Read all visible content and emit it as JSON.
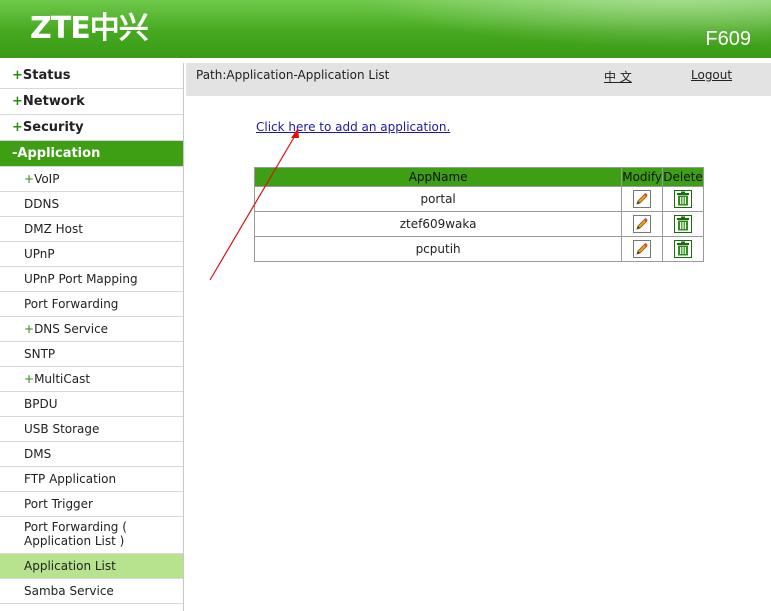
{
  "header": {
    "logo": "ZTE中兴",
    "model": "F609"
  },
  "sidebar": {
    "items": [
      {
        "sign": "+",
        "label": "Status"
      },
      {
        "sign": "+",
        "label": "Network"
      },
      {
        "sign": "+",
        "label": "Security"
      },
      {
        "sign": "-",
        "label": "Application"
      },
      {
        "sign": "+",
        "label": "VoIP"
      },
      {
        "sign": "",
        "label": "DDNS"
      },
      {
        "sign": "",
        "label": "DMZ Host"
      },
      {
        "sign": "",
        "label": "UPnP"
      },
      {
        "sign": "",
        "label": "UPnP Port Mapping"
      },
      {
        "sign": "",
        "label": "Port Forwarding"
      },
      {
        "sign": "+",
        "label": "DNS Service"
      },
      {
        "sign": "",
        "label": "SNTP"
      },
      {
        "sign": "+",
        "label": "MultiCast"
      },
      {
        "sign": "",
        "label": "BPDU"
      },
      {
        "sign": "",
        "label": "USB Storage"
      },
      {
        "sign": "",
        "label": "DMS"
      },
      {
        "sign": "",
        "label": "FTP Application"
      },
      {
        "sign": "",
        "label": "Port Trigger"
      },
      {
        "sign": "",
        "label": "Port Forwarding ( Application List )"
      },
      {
        "sign": "",
        "label": "Application List"
      },
      {
        "sign": "",
        "label": "Samba Service"
      }
    ]
  },
  "topbar": {
    "path": "Path:Application-Application List",
    "language": "中 文",
    "logout": "Logout"
  },
  "main": {
    "add_link": "Click here to add an application.",
    "table": {
      "headers": [
        "AppName",
        "Modify",
        "Delete"
      ],
      "rows": [
        {
          "name": "portal"
        },
        {
          "name": "ztef609waka"
        },
        {
          "name": "pcputih"
        }
      ]
    }
  },
  "colors": {
    "brand_green": "#3f9f14",
    "selected_row": "#b7e38e",
    "link_blue": "#1a1aa8",
    "annotation_red": "#e01010"
  },
  "icons": {
    "modify": "pencil-edit-icon",
    "delete": "trash-bin-icon"
  }
}
